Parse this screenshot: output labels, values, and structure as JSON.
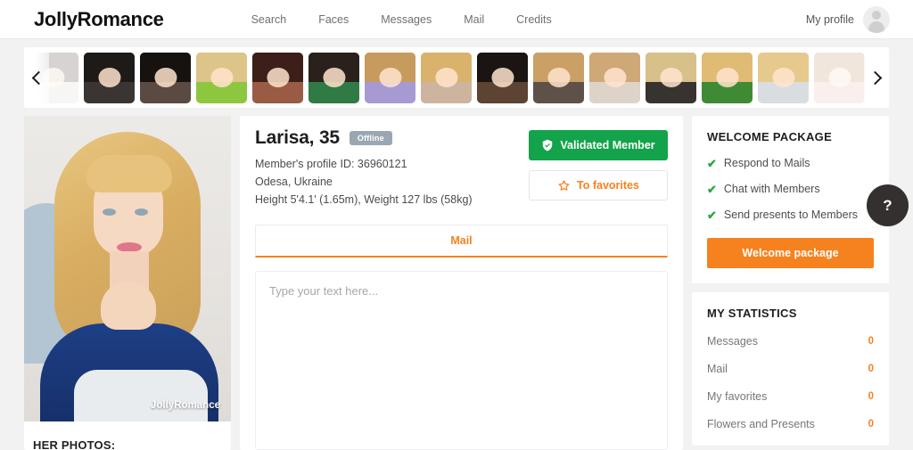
{
  "header": {
    "logo": "JollyRomance",
    "nav": [
      {
        "label": "Search"
      },
      {
        "label": "Faces"
      },
      {
        "label": "Messages"
      },
      {
        "label": "Mail"
      },
      {
        "label": "Credits"
      }
    ],
    "profile_label": "My profile",
    "avatar_icon": "user-placeholder-icon"
  },
  "carousel": {
    "prev_icon": "chevron-left-icon",
    "next_icon": "chevron-right-icon",
    "thumbnails": [
      {
        "alt": "member-thumbnail-1",
        "hair": "#4a3a32",
        "bg": "#d8d5d2",
        "faded": true
      },
      {
        "alt": "member-thumbnail-2",
        "hair": "#1d1a18",
        "bg": "#3a3432",
        "faded": false
      },
      {
        "alt": "member-thumbnail-3",
        "hair": "#16120f",
        "bg": "#5a4a42",
        "faded": false
      },
      {
        "alt": "member-thumbnail-4",
        "hair": "#ddc489",
        "bg": "#8dc63f",
        "faded": false
      },
      {
        "alt": "member-thumbnail-5",
        "hair": "#3b1f18",
        "bg": "#9a5b45",
        "faded": false
      },
      {
        "alt": "member-thumbnail-6",
        "hair": "#2a211c",
        "bg": "#2f7a45",
        "faded": false
      },
      {
        "alt": "member-thumbnail-7",
        "hair": "#c79a5e",
        "bg": "#a79ad3",
        "faded": false
      },
      {
        "alt": "member-thumbnail-8",
        "hair": "#d9b26c",
        "bg": "#cdb49f",
        "faded": false
      },
      {
        "alt": "member-thumbnail-9",
        "hair": "#1a1512",
        "bg": "#5c4332",
        "faded": false
      },
      {
        "alt": "member-thumbnail-10",
        "hair": "#caa067",
        "bg": "#5e5148",
        "faded": false
      },
      {
        "alt": "member-thumbnail-11",
        "hair": "#cfa877",
        "bg": "#ded3c8",
        "faded": false
      },
      {
        "alt": "member-thumbnail-12",
        "hair": "#d8c08a",
        "bg": "#37332f",
        "faded": false
      },
      {
        "alt": "member-thumbnail-13",
        "hair": "#e0bb74",
        "bg": "#3f8a35",
        "faded": false
      },
      {
        "alt": "member-thumbnail-14",
        "hair": "#e6c98c",
        "bg": "#d9dde0",
        "faded": false
      },
      {
        "alt": "member-thumbnail-15",
        "hair": "#b98f5e",
        "bg": "#e3b4ae",
        "faded": true
      }
    ]
  },
  "photo": {
    "watermark": "JollyRomance",
    "her_photos_label": "HER PHOTOS:"
  },
  "profile": {
    "name_age": "Larisa, 35",
    "status_badge": "Offline",
    "member_id": "Member's profile ID: 36960121",
    "location": "Odesa, Ukraine",
    "measurements": "Height 5'4.1' (1.65m), Weight 127 lbs (58kg)",
    "validated_label": "Validated Member",
    "validated_icon": "shield-check-icon",
    "favorites_label": "To favorites",
    "favorites_icon": "star-outline-icon",
    "validated_color": "#13a34b",
    "accent_color": "#f5821f"
  },
  "composer": {
    "tab_label": "Mail",
    "placeholder": "Type your text here..."
  },
  "welcome_package": {
    "title": "WELCOME PACKAGE",
    "perks": [
      {
        "label": "Respond to Mails"
      },
      {
        "label": "Chat with Members"
      },
      {
        "label": "Send presents to Members"
      }
    ],
    "check_icon": "check-icon",
    "button_label": "Welcome package"
  },
  "statistics": {
    "title": "MY STATISTICS",
    "rows": [
      {
        "label": "Messages",
        "value": "0"
      },
      {
        "label": "Mail",
        "value": "0"
      },
      {
        "label": "My favorites",
        "value": "0"
      },
      {
        "label": "Flowers and Presents",
        "value": "0"
      }
    ]
  },
  "help": {
    "label": "?",
    "icon": "question-mark-icon"
  }
}
